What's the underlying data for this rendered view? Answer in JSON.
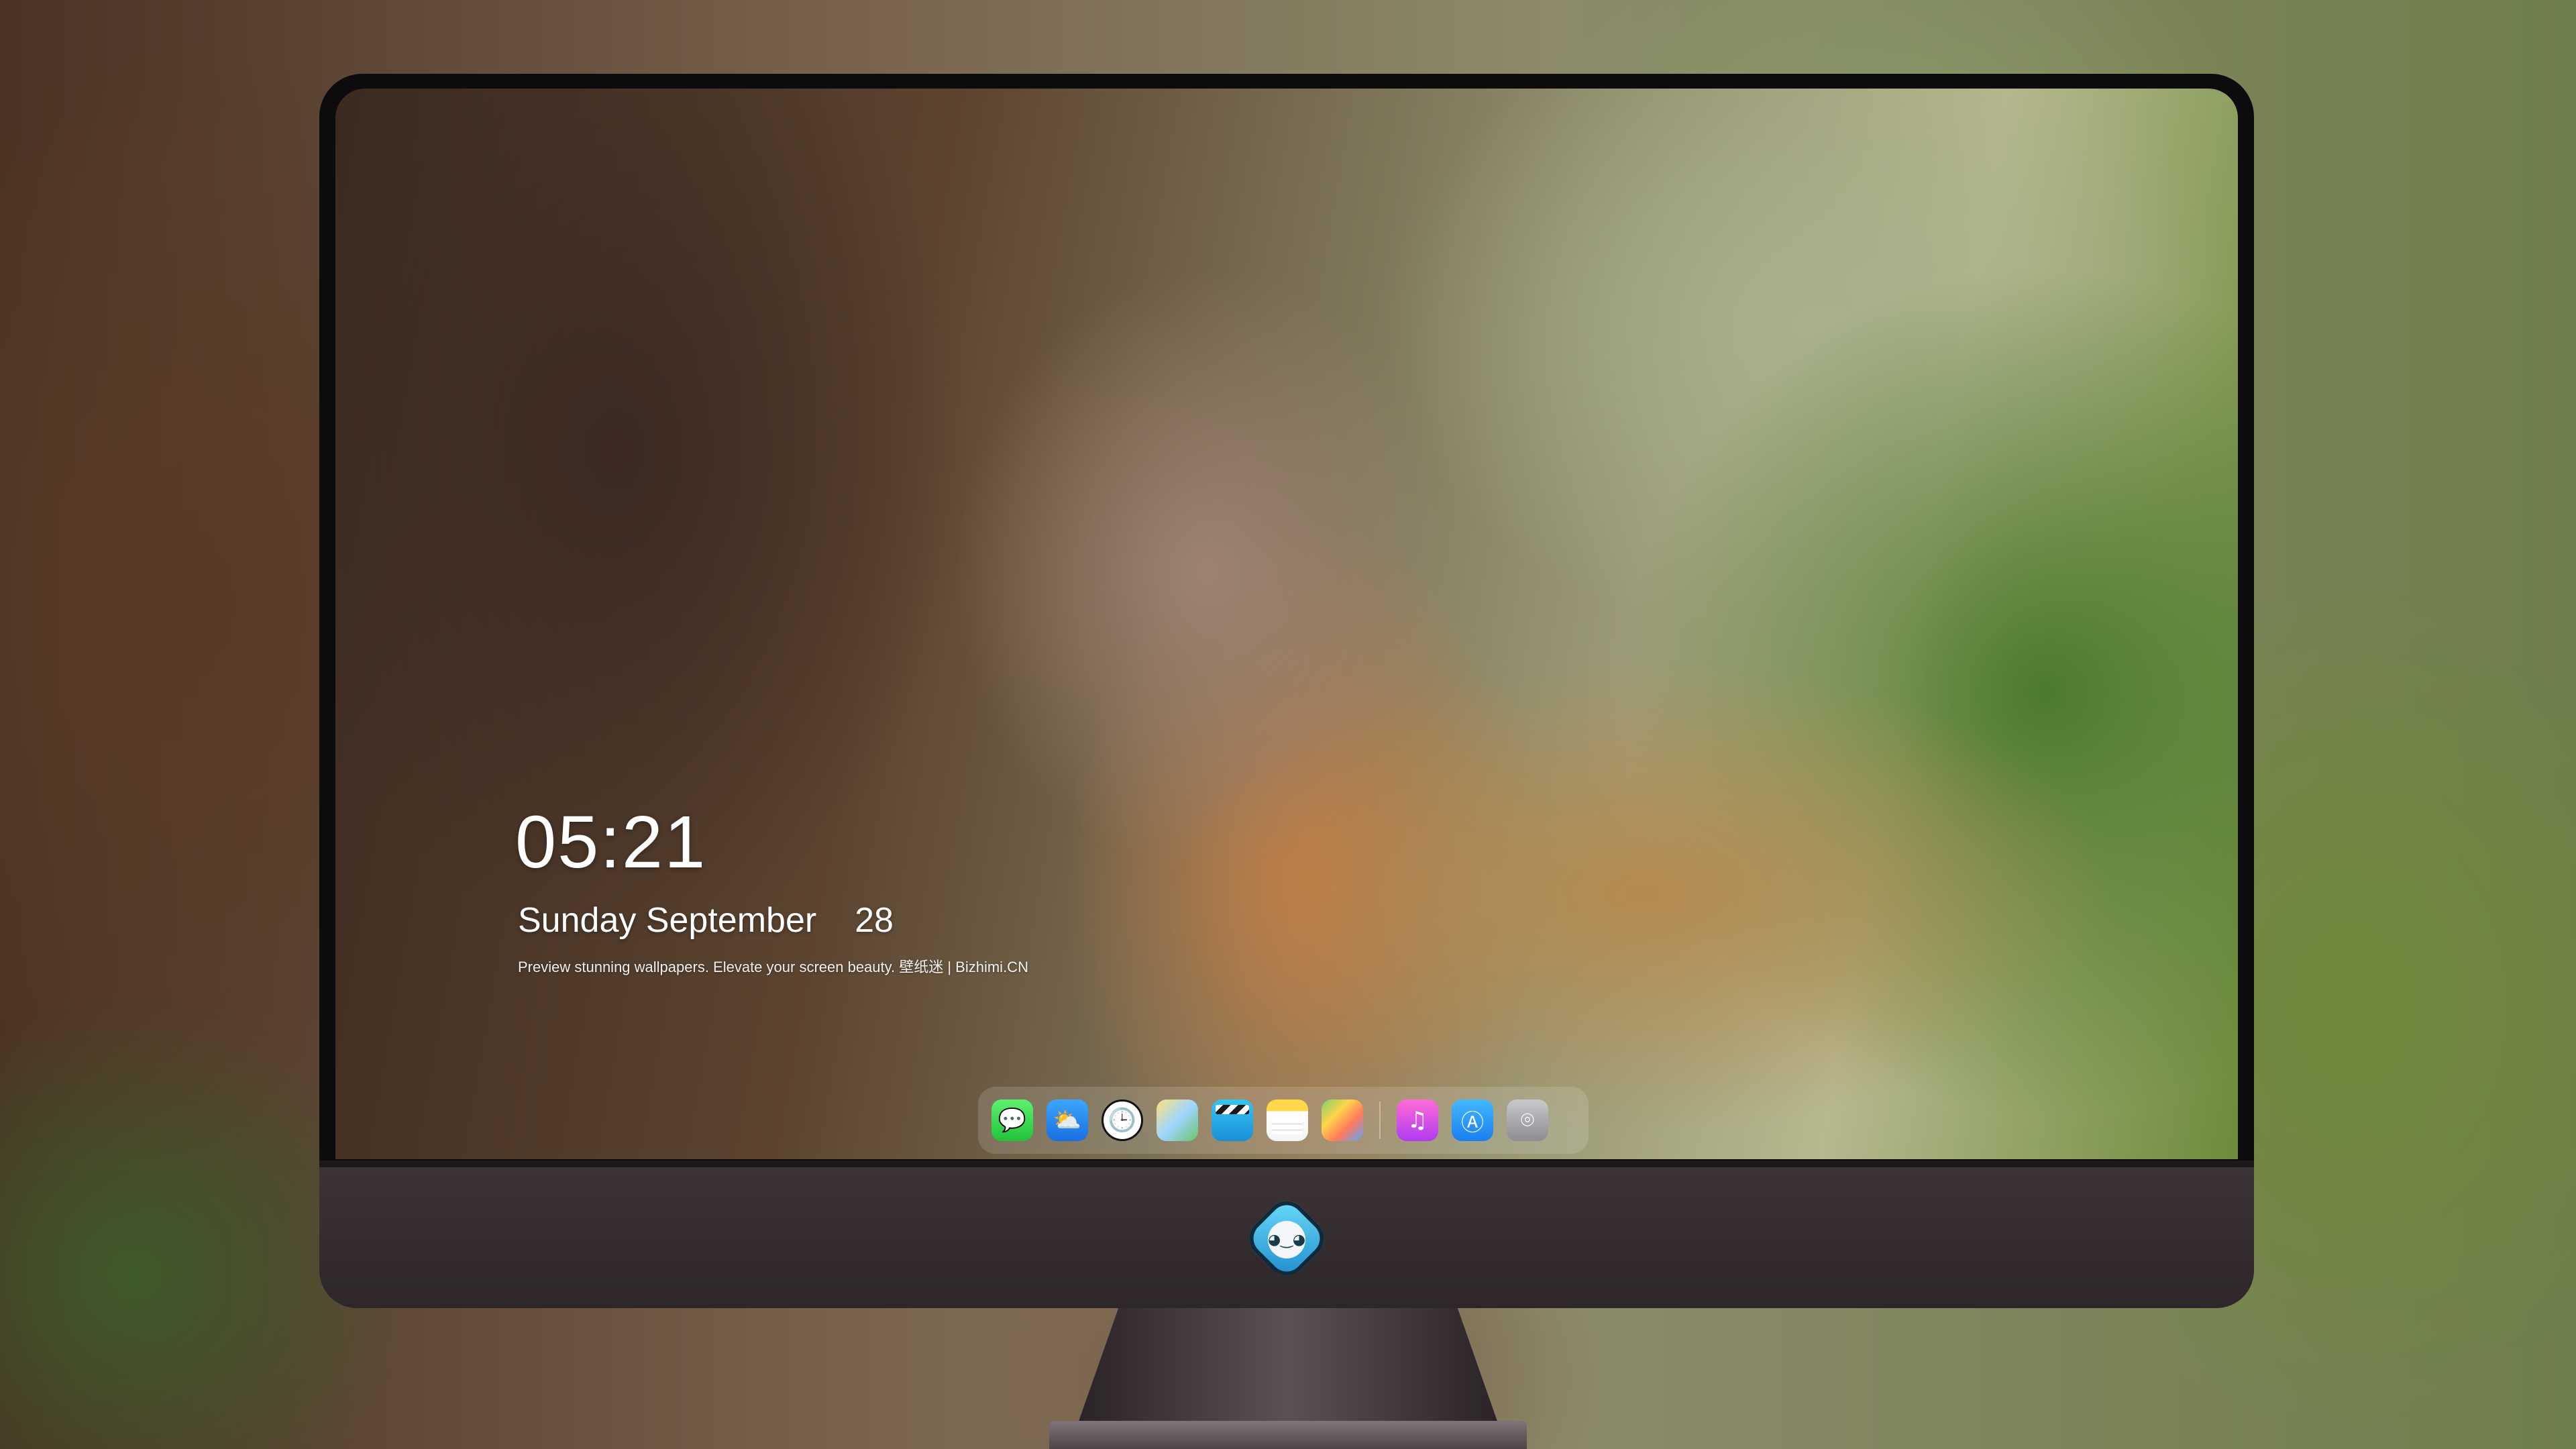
{
  "lockscreen": {
    "time": "05:21",
    "weekday": "Sunday",
    "month": "September",
    "day": "28",
    "tagline": "Preview stunning wallpapers. Elevate your screen beauty. 壁纸迷 | Bizhimi.CN"
  },
  "dock": {
    "apps": [
      {
        "name": "Messages",
        "icon": "messages-icon",
        "glyph": "💬"
      },
      {
        "name": "Weather",
        "icon": "weather-icon",
        "glyph": "⛅"
      },
      {
        "name": "Clock",
        "icon": "clock-icon",
        "glyph": "🕒"
      },
      {
        "name": "Maps",
        "icon": "maps-icon",
        "glyph": ""
      },
      {
        "name": "Clips",
        "icon": "clips-icon",
        "glyph": ""
      },
      {
        "name": "Notes",
        "icon": "notes-icon",
        "glyph": ""
      },
      {
        "name": "Photos",
        "icon": "photos-icon",
        "glyph": ""
      },
      {
        "name": "Music",
        "icon": "music-icon",
        "glyph": "♫"
      },
      {
        "name": "App Store",
        "icon": "app-store-icon",
        "glyph": "Ⓐ"
      },
      {
        "name": "Camera",
        "icon": "camera-icon",
        "glyph": "⌾"
      }
    ]
  },
  "colors": {
    "bezel": "#0d0b0d",
    "chin": "#3b3336",
    "text": "#ffffff"
  }
}
